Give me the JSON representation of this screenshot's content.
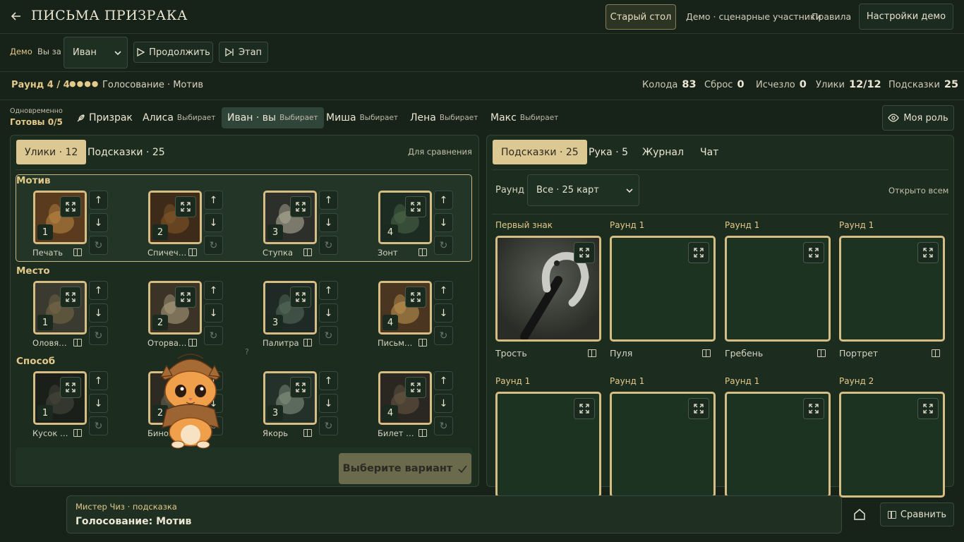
{
  "header": {
    "title": "ПИСЬМА ПРИЗРАКА",
    "old_table": "Старый стол",
    "demo_participants": "Демо · сценарные участники",
    "rules": "Правила",
    "demo_settings": "Настройки демо"
  },
  "controls": {
    "demo": "Демо",
    "you_for": "Вы за",
    "player": "Иван",
    "continue": "Продолжить",
    "stage": "Этап"
  },
  "round": {
    "label": "Раунд 4 / 4",
    "dots": "●●●●",
    "phase": "Голосование · Мотив",
    "stats": [
      {
        "label": "Колода",
        "value": "83"
      },
      {
        "label": "Сброс",
        "value": "0"
      },
      {
        "label": "Исчезло",
        "value": "0"
      },
      {
        "label": "Улики",
        "value": "12/12"
      },
      {
        "label": "Подсказки",
        "value": "25"
      }
    ]
  },
  "players": {
    "simultaneous": "Одновременно",
    "ready": "Готовы 0/5",
    "ghost": "Призрак",
    "list": [
      {
        "name": "Алиса",
        "status": "Выбирает"
      },
      {
        "name": "Иван · вы",
        "status": "Выбирает"
      },
      {
        "name": "Миша",
        "status": "Выбирает"
      },
      {
        "name": "Лена",
        "status": "Выбирает"
      },
      {
        "name": "Макс",
        "status": "Выбирает"
      }
    ],
    "my_role": "Моя роль"
  },
  "left": {
    "tab_clues": "Улики · 12",
    "tab_hints": "Подсказки · 25",
    "compare_note": "Для сравнения",
    "categories": [
      {
        "title": "Мотив",
        "cards": [
          {
            "num": "1",
            "label": "Печать"
          },
          {
            "num": "2",
            "label": "Спичечный коробок"
          },
          {
            "num": "3",
            "label": "Ступка"
          },
          {
            "num": "4",
            "label": "Зонт"
          }
        ]
      },
      {
        "title": "Место",
        "cards": [
          {
            "num": "1",
            "label": "Оловянный солдатик"
          },
          {
            "num": "2",
            "label": "Оторванная страница"
          },
          {
            "num": "3",
            "label": "Палитра"
          },
          {
            "num": "4",
            "label": "Письменный стол"
          }
        ]
      },
      {
        "title": "Способ",
        "cards": [
          {
            "num": "1",
            "label": "Кусок угля"
          },
          {
            "num": "2",
            "label": "Бинокль"
          },
          {
            "num": "3",
            "label": "Якорь"
          },
          {
            "num": "4",
            "label": "Билет на поезд"
          }
        ]
      }
    ],
    "question_mark": "?",
    "choose": "Выберите вариант"
  },
  "right": {
    "tab_hints": "Подсказки · 25",
    "tab_hand": "Рука · 5",
    "tab_journal": "Журнал",
    "tab_chat": "Чат",
    "round_label": "Раунд",
    "round_value": "Все · 25 карт",
    "open_all": "Открыто всем",
    "hints": [
      {
        "round": "Первый знак",
        "name": "Трость"
      },
      {
        "round": "Раунд 1",
        "name": "Пуля"
      },
      {
        "round": "Раунд 1",
        "name": "Гребень"
      },
      {
        "round": "Раунд 1",
        "name": "Портрет"
      },
      {
        "round": "Раунд 1",
        "name": ""
      },
      {
        "round": "Раунд 1",
        "name": ""
      },
      {
        "round": "Раунд 1",
        "name": ""
      },
      {
        "round": "Раунд 2",
        "name": ""
      }
    ]
  },
  "bottom": {
    "hint_from": "Мистер Чиз · подсказка",
    "hint_text": "Голосование: Мотив",
    "compare": "Сравнить"
  }
}
